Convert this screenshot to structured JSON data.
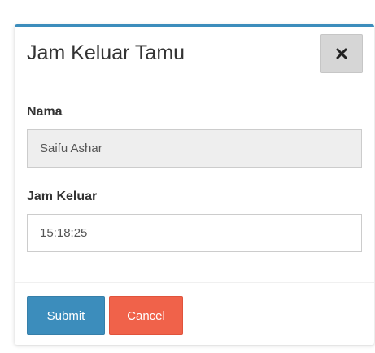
{
  "modal": {
    "title": "Jam Keluar Tamu",
    "close_icon": "times-icon"
  },
  "form": {
    "nama_label": "Nama",
    "nama_value": "Saifu Ashar",
    "jam_keluar_label": "Jam Keluar",
    "jam_keluar_value": "15:18:25"
  },
  "footer": {
    "submit_label": "Submit",
    "cancel_label": "Cancel"
  },
  "colors": {
    "accent": "#3c8dbc",
    "submit": "#3c8dbc",
    "cancel": "#f0624a",
    "close_bg": "#d6d6d6"
  }
}
